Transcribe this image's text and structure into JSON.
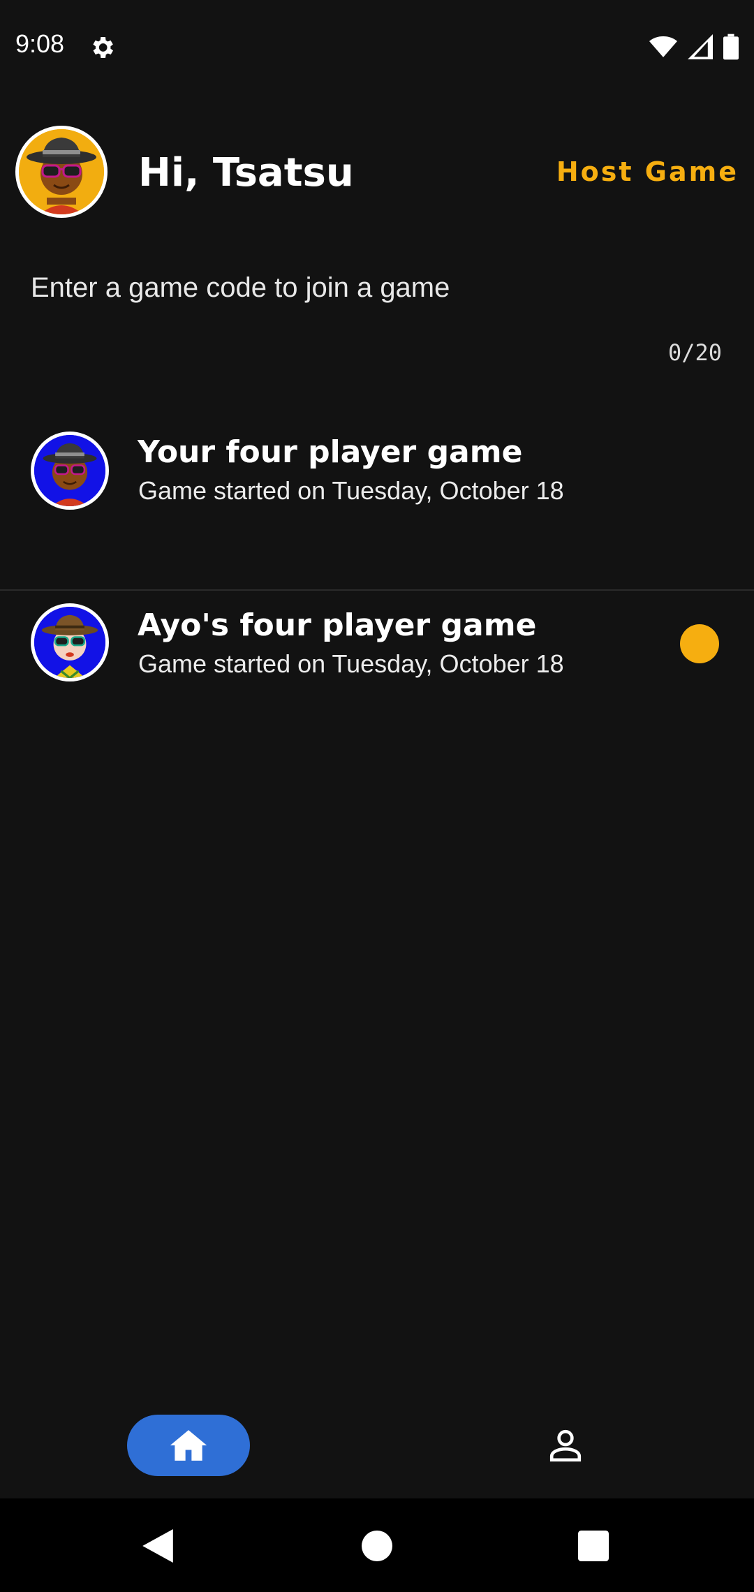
{
  "status_bar": {
    "time": "9:08",
    "icons": [
      "gear-icon",
      "wifi-icon",
      "signal-icon",
      "battery-icon"
    ]
  },
  "header": {
    "greeting": "Hi, Tsatsu",
    "host_button_label": "Host Game"
  },
  "game_code": {
    "placeholder": "Enter a game code to join a game",
    "value": "",
    "counter": "0/20"
  },
  "games": [
    {
      "title": "Your four player game",
      "subtitle": "Game started on Tuesday, October 18",
      "unread": false
    },
    {
      "title": "Ayo's four player game",
      "subtitle": "Game started on Tuesday, October 18",
      "unread": true
    }
  ],
  "bottom_nav": {
    "items": [
      "home-icon",
      "profile-icon"
    ],
    "active": "home"
  },
  "colors": {
    "accent": "#f6ae10",
    "nav_active": "#2f6fd6",
    "background": "#121212",
    "avatar_blue": "#1212e6"
  }
}
